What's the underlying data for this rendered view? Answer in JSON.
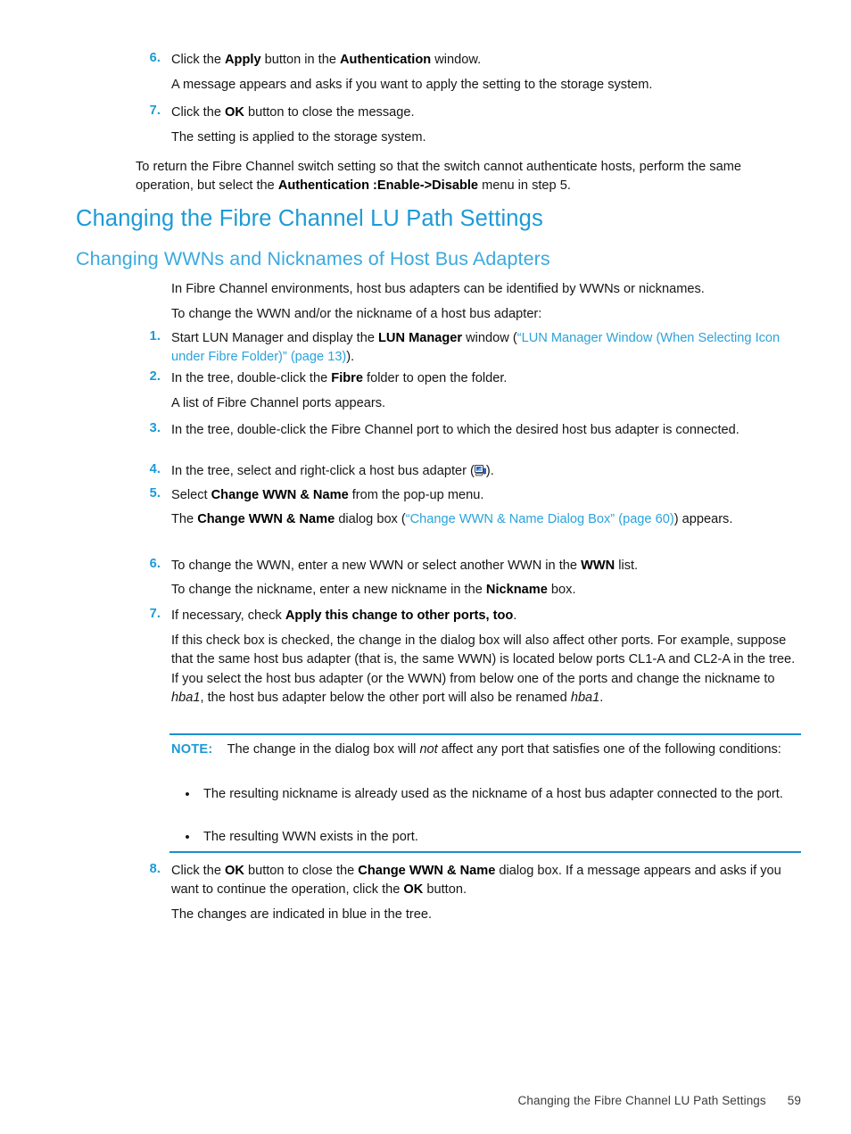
{
  "steps_top": [
    {
      "num": "6.",
      "text_parts": [
        "Click the ",
        "Apply",
        " button in the ",
        "Authentication",
        " window."
      ],
      "result": "A message appears and asks if you want to apply the setting to the storage system."
    },
    {
      "num": "7.",
      "text_parts": [
        "Click the ",
        "OK",
        " button to close the message."
      ],
      "result": "The setting is applied to the storage system."
    }
  ],
  "intro_paragraph": {
    "part1": "To return the Fibre Channel switch setting so that the switch cannot authenticate hosts, perform the same operation, but select the ",
    "bold": "Authentication :Enable->Disable",
    "part2": " menu in step 5."
  },
  "heading1": "Changing the Fibre Channel LU Path Settings",
  "heading2": "Changing WWNs and Nicknames of Host Bus Adapters",
  "lead_paragraphs": [
    "In Fibre Channel environments, host bus adapters can be identified by WWNs or nicknames.",
    "To change the WWN and/or the nickname of a host bus adapter:"
  ],
  "procedure": {
    "step1": {
      "num": "1.",
      "pre": "Start LUN Manager and display the ",
      "bold": "LUN Manager",
      "mid": " window (",
      "link": "“LUN Manager Window (When Selecting Icon under Fibre Folder)” (page 13)",
      "post": ")."
    },
    "step2": {
      "num": "2.",
      "pre": "In the tree, double-click the ",
      "bold": "Fibre",
      "post": " folder to open the folder.",
      "result": "A list of Fibre Channel ports appears."
    },
    "step3": {
      "num": "3.",
      "text": "In the tree, double-click the Fibre Channel port to which the desired host bus adapter is connected."
    },
    "step4": {
      "num": "4.",
      "pre": "In the tree, select and right-click a host bus adapter (",
      "icon": "host-bus-adapter-icon",
      "post": ")."
    },
    "step5": {
      "num": "5.",
      "pre": "Select ",
      "bold": "Change WWN & Name",
      "post": " from the pop-up menu.",
      "result_pre": "The ",
      "result_bold": "Change WWN & Name",
      "result_mid": " dialog box (",
      "result_link": "“Change WWN & Name Dialog Box” (page 60)",
      "result_post": ") appears."
    },
    "step6": {
      "num": "6.",
      "pre": "To change the WWN, enter a new WWN or select another WWN in the ",
      "bold": "WWN",
      "post": " list.",
      "result_pre": "To change the nickname, enter a new nickname in the ",
      "result_bold": "Nickname",
      "result_post": " box."
    },
    "step7": {
      "num": "7.",
      "pre": "If necessary, check ",
      "bold": "Apply this change to other ports, too",
      "post": ".",
      "para_a": "If this check box is checked, the change in the dialog box will also affect other ports. For example, suppose that the same host bus adapter (that is, the same WWN) is located below ports CL1-A and CL2-A in the tree. If you select the host bus adapter (or the WWN) from below one of the ports and change the nickname to ",
      "para_italic1": "hba1",
      "para_b": ", the host bus adapter below the other port will also be renamed ",
      "para_italic2": "hba1",
      "para_c": "."
    },
    "step8": {
      "num": "8.",
      "pre": "Click the ",
      "bold1": "OK",
      "mid1": " button to close the ",
      "bold2": "Change WWN & Name",
      "mid2": " dialog box. If a message appears and asks if you want to continue the operation, click the ",
      "bold3": "OK",
      "post": " button.",
      "result": "The changes are indicated in blue in the tree."
    }
  },
  "note": {
    "label": "NOTE:",
    "body_pre": "The change in the dialog box will ",
    "body_italic": "not",
    "body_post": " affect any port that satisfies one of the following conditions:",
    "bullet_char": "•",
    "bullets": [
      "The resulting nickname is already used as the nickname of a host bus adapter connected to the port.",
      "The resulting WWN exists in the port."
    ]
  },
  "footer": {
    "chapter": "Changing the Fibre Channel LU Path Settings",
    "page": "59"
  },
  "colors": {
    "heading_blue": "#1c9ad6",
    "subheading_blue": "#3aa9de",
    "link_blue": "#2ba3da",
    "rule_blue": "#1c8fcd",
    "text_black": "#161616"
  }
}
